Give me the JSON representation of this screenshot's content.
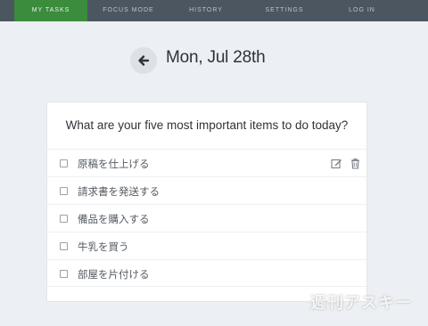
{
  "nav": {
    "items": [
      {
        "label": "MY TASKS",
        "active": true
      },
      {
        "label": "FOCUS MODE",
        "active": false
      },
      {
        "label": "HISTORY",
        "active": false
      },
      {
        "label": "SETTINGS",
        "active": false
      },
      {
        "label": "LOG IN",
        "active": false
      }
    ]
  },
  "date": {
    "title": "Mon, Jul 28th",
    "back_icon": "arrow-left-icon"
  },
  "card": {
    "question": "What are your five most important items to do today?",
    "tasks": [
      {
        "text": "原稿を仕上げる",
        "checked": false
      },
      {
        "text": "請求書を発送する",
        "checked": false
      },
      {
        "text": "備品を購入する",
        "checked": false
      },
      {
        "text": "牛乳を買う",
        "checked": false
      },
      {
        "text": "部屋を片付ける",
        "checked": false
      }
    ],
    "row_action_icons": [
      "edit-icon",
      "trash-icon"
    ]
  },
  "watermark": "週刊アスキー",
  "colors": {
    "nav_bg": "#4b5661",
    "nav_active": "#3b8c3c",
    "page_bg": "#eceff3"
  }
}
